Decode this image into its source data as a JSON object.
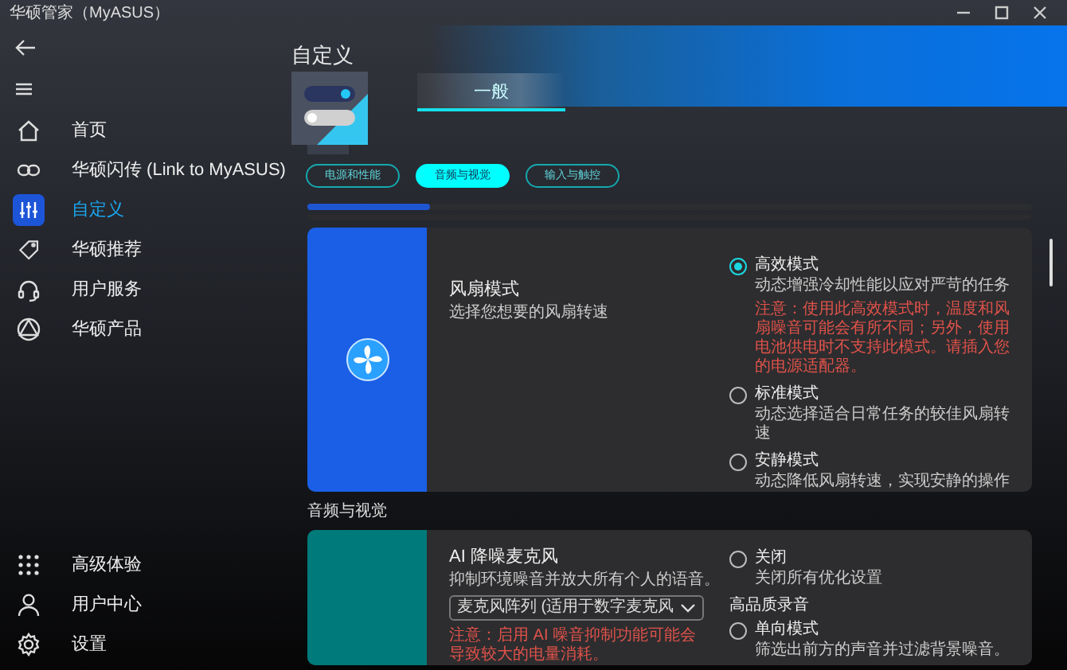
{
  "window": {
    "title": "华硕管家（MyASUS）"
  },
  "sidebar": {
    "items": [
      {
        "label": "首页",
        "selected": false
      },
      {
        "label": "华硕闪传 (Link to MyASUS)",
        "selected": false
      },
      {
        "label": "自定义",
        "selected": true
      },
      {
        "label": "华硕推荐",
        "selected": false
      },
      {
        "label": "用户服务",
        "selected": false
      },
      {
        "label": "华硕产品",
        "selected": false
      }
    ],
    "bottom_items": [
      {
        "label": "高级体验",
        "selected": false
      },
      {
        "label": "用户中心",
        "selected": false
      },
      {
        "label": "设置",
        "selected": false
      }
    ]
  },
  "page": {
    "title": "自定义",
    "tabs": [
      {
        "label": "一般",
        "selected": true
      }
    ],
    "categories": [
      {
        "label": "电源和性能",
        "selected": false
      },
      {
        "label": "音频与视觉",
        "selected": true
      },
      {
        "label": "输入与触控",
        "selected": false
      }
    ],
    "progress": {
      "level": 0.17
    }
  },
  "sections": [
    {
      "cards": [
        {
          "color": "#1a5fe6",
          "title": "风扇模式",
          "description": "选择您想要的风扇转速",
          "items": [
            {
              "kind": "radio",
              "label": "高效模式",
              "description": "动态增强冷却性能以应对严苛的任务",
              "warning": "注意：使用此高效模式时，温度和风扇噪音可能会有所不同；另外，使用电池供电时不支持此模式。请插入您的电源适配器。",
              "selected": true
            },
            {
              "kind": "radio",
              "label": "标准模式",
              "description": "动态选择适合日常任务的较佳风扇转速",
              "selected": false
            },
            {
              "kind": "radio",
              "label": "安静模式",
              "description": "动态降低风扇转速，实现安静的操作",
              "selected": false
            }
          ]
        }
      ]
    },
    {
      "heading": "音频与视觉",
      "cards": [
        {
          "color": "#007a7a",
          "title": "AI 降噪麦克风",
          "description": "抑制环境噪音并放大所有个人的语音。",
          "dropdown": {
            "value": "麦克风阵列 (适用于数字麦克风"
          },
          "warning": "注意：启用 AI 噪音抑制功能可能会导致较大的电量消耗。",
          "items": [
            {
              "kind": "radio",
              "label": "关闭",
              "description": "关闭所有优化设置",
              "selected": false
            },
            {
              "kind": "group",
              "label": "高品质录音"
            },
            {
              "kind": "radio",
              "label": "单向模式",
              "description": "筛选出前方的声音并过滤背景噪音。",
              "selected": false
            }
          ]
        }
      ]
    }
  ]
}
